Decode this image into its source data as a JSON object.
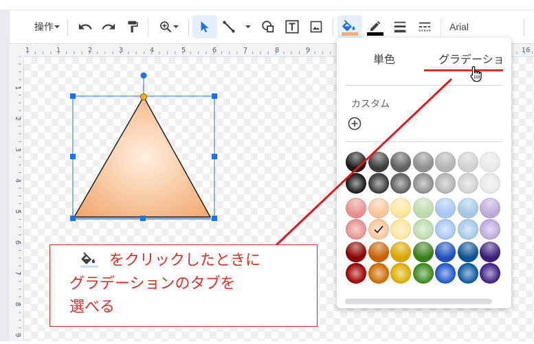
{
  "toolbar": {
    "operations_label": "操作",
    "font_name": "Arial",
    "accent_color": "#1a73e8",
    "fill_bar_color": "#f6b26b"
  },
  "ruler": {
    "top_labels": [
      "1",
      "1",
      "2",
      "3",
      "4",
      "5",
      "6",
      "7",
      "8",
      "9",
      "16"
    ],
    "left_labels": [
      "1",
      "2",
      "3",
      "4",
      "5",
      "6",
      "7",
      "8",
      "9"
    ]
  },
  "fill_popup": {
    "tabs": [
      {
        "label": "単色",
        "active": false
      },
      {
        "label": "グラデーショ",
        "active": true
      }
    ],
    "custom_label": "カスタム",
    "gradient_rows": [
      [
        "#1c1c1c",
        "#3d3d3d",
        "#616161",
        "#8f8f8f",
        "#b3b3b3",
        "#d1d1d1",
        "#e8e8e8"
      ],
      [
        "#1c1c1c",
        "#3d3d3d",
        "#616161",
        "#8f8f8f",
        "#b3b3b3",
        "#d1d1d1",
        "#e8e8e8"
      ],
      [
        "#e89090",
        "#f9c59b",
        "#fde59a",
        "#bcdbad",
        "#a7c6f5",
        "#a6c8e6",
        "#bdaadc"
      ],
      [
        "#e89090",
        "#f9c59b",
        "#fde59a",
        "#bcdbad",
        "#a7c6f5",
        "#a6c8e6",
        "#bdaadc"
      ],
      [
        "#8b0000",
        "#c96000",
        "#d8a500",
        "#3a7d1a",
        "#1f4fc0",
        "#0b5394",
        "#3b1e7a"
      ],
      [
        "#a00000",
        "#d06a00",
        "#e0ac00",
        "#3d8a1d",
        "#2356cf",
        "#0d5ca3",
        "#40208a"
      ]
    ],
    "selected_swatch": {
      "row": 3,
      "col": 1
    }
  },
  "callout": {
    "line1": "をクリックしたときに",
    "line2": "グラデーションのタブを",
    "line3": "選べる",
    "color": "#d93025"
  }
}
